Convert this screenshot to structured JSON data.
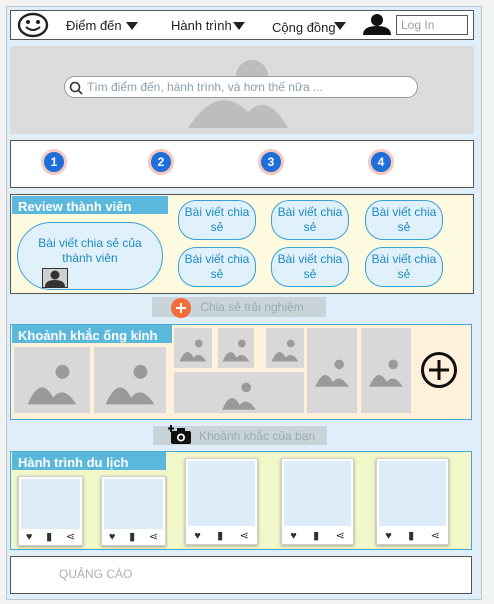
{
  "header": {
    "nav": [
      {
        "label": "Điểm đến"
      },
      {
        "label": "Hành trình"
      },
      {
        "label": "Cộng đồng"
      }
    ],
    "login_placeholder": "Log In"
  },
  "hero": {
    "search_placeholder": "Tìm điểm đến, hành trình, và hơn thế nữa ..."
  },
  "steps": [
    "1",
    "2",
    "3",
    "4"
  ],
  "review": {
    "title": "Review thành viên",
    "main_bubble": "Bài viết chia sẻ của thành viên",
    "bubbles": [
      "Bài viết chia sẻ",
      "Bài viết chia sẻ",
      "Bài viết chia sẻ",
      "Bài viết chia sẻ",
      "Bài viết chia sẻ",
      "Bài viết chia sẻ"
    ],
    "share_button": "Chia sẻ trải nghiệm"
  },
  "moments": {
    "title": "Khoảnh khắc ống kính",
    "your_moment_button": "Khoảnh khắc của bạn"
  },
  "journeys": {
    "title": "Hành trình du lịch"
  },
  "ad": {
    "label": "QUẢNG CÁO"
  },
  "colors": {
    "accent": "#5ab8dc",
    "step_blue": "#1e6fd9",
    "review_bg": "#fefae0",
    "moments_bg": "#fff0dc",
    "journeys_bg": "#f2f7c9",
    "share_plus": "#f26b3a"
  }
}
